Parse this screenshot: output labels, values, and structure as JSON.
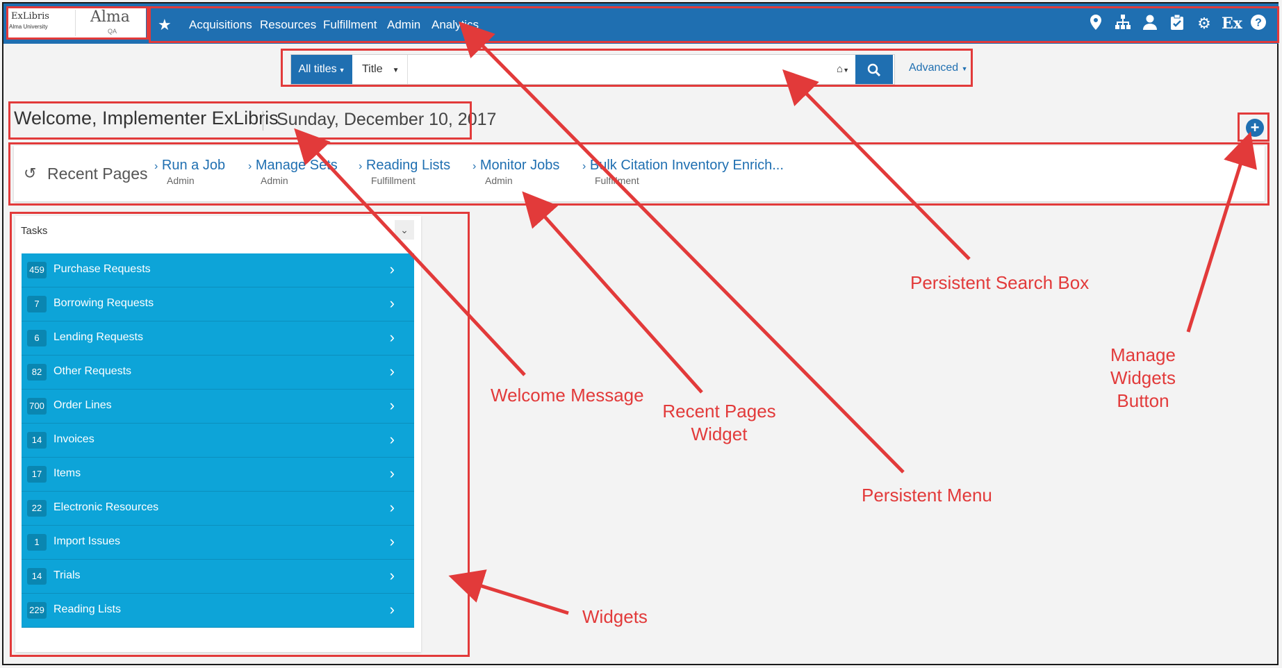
{
  "logo": {
    "brand": "ExLibris",
    "institution": "Alma University",
    "product": "Alma",
    "environment": "QA"
  },
  "nav": {
    "favorites_icon": "star-icon",
    "menu_items": [
      "Acquisitions",
      "Resources",
      "Fulfillment",
      "Admin",
      "Analytics"
    ],
    "right_icons": [
      "location-icon",
      "hierarchy-icon",
      "user-icon",
      "clipboard-icon",
      "gear-icon",
      "exlibris-icon",
      "help-icon"
    ],
    "color": "#1f6fb1"
  },
  "search": {
    "scope": "All titles",
    "field": "Title",
    "query": "",
    "advanced": "Advanced"
  },
  "welcome": {
    "message": "Welcome, Implementer ExLibris",
    "date": "Sunday, December 10, 2017"
  },
  "recent": {
    "title": "Recent Pages",
    "items": [
      {
        "label": "Run a Job",
        "area": "Admin"
      },
      {
        "label": "Manage Sets",
        "area": "Admin"
      },
      {
        "label": "Reading Lists",
        "area": "Fulfillment"
      },
      {
        "label": "Monitor Jobs",
        "area": "Admin"
      },
      {
        "label": "Bulk Citation Inventory Enrich...",
        "area": "Fulfillment"
      }
    ]
  },
  "tasks": {
    "title": "Tasks",
    "color": "#0da4d8",
    "items": [
      {
        "count": "459",
        "label": "Purchase Requests"
      },
      {
        "count": "7",
        "label": "Borrowing Requests"
      },
      {
        "count": "6",
        "label": "Lending Requests"
      },
      {
        "count": "82",
        "label": "Other Requests"
      },
      {
        "count": "700",
        "label": "Order Lines"
      },
      {
        "count": "14",
        "label": "Invoices"
      },
      {
        "count": "17",
        "label": "Items"
      },
      {
        "count": "22",
        "label": "Electronic Resources"
      },
      {
        "count": "1",
        "label": "Import Issues"
      },
      {
        "count": "14",
        "label": "Trials"
      },
      {
        "count": "229",
        "label": "Reading Lists"
      }
    ]
  },
  "annotations": {
    "color": "#e23a3a",
    "search_box": "Persistent Search Box",
    "manage_widgets_1": "Manage Widgets",
    "manage_widgets_2": "Button",
    "welcome_message": "Welcome Message",
    "recent_pages_1": "Recent Pages",
    "recent_pages_2": "Widget",
    "persistent_menu": "Persistent Menu",
    "widgets": "Widgets"
  }
}
